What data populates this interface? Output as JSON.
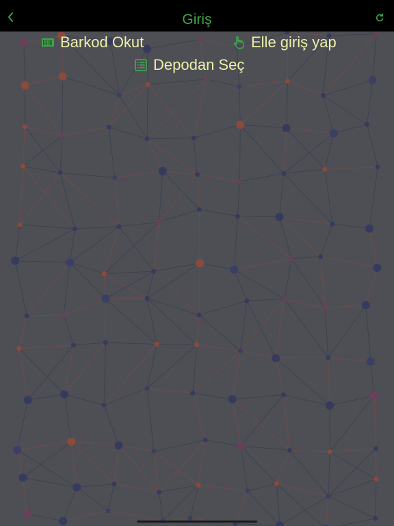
{
  "header": {
    "title": "Giriş"
  },
  "actions": {
    "barcode_label": "Barkod Okut",
    "manual_label": "Elle giriş yap",
    "depot_label": "Depodan Seç"
  },
  "colors": {
    "header_bg": "#000000",
    "accent_green": "#3fa54a",
    "action_text": "#eef0a8",
    "background": "#4d4f55"
  },
  "icons": {
    "back": "chevron-left-icon",
    "refresh": "refresh-icon",
    "barcode": "barcode-icon",
    "manual": "hand-pointer-icon",
    "depot": "list-icon"
  }
}
